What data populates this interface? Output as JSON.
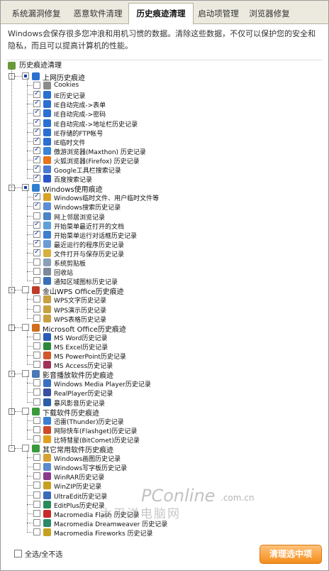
{
  "tabs": [
    "系统漏洞修复",
    "恶意软件清理",
    "历史痕迹清理",
    "启动项管理",
    "浏览器修复"
  ],
  "description": "Windows会保存很多您冲浪和用机习惯的数据。清除这些数据，不仅可以保护您的安全和隐私，而且可以提高计算机的性能。",
  "tree_root": "历史痕迹清理",
  "groups": [
    {
      "label": "上网历史痕迹",
      "state": "part",
      "color": "#2b6fd1",
      "items": [
        {
          "label": "Cookies",
          "checked": false,
          "icon": "#8b8b8b"
        },
        {
          "label": "IE历史记录",
          "checked": true,
          "icon": "#2b6fd1"
        },
        {
          "label": "IE自动完成->表单",
          "checked": true,
          "icon": "#2b6fd1"
        },
        {
          "label": "IE自动完成->密码",
          "checked": true,
          "icon": "#2b6fd1"
        },
        {
          "label": "IE自动完成->地址栏历史记录",
          "checked": true,
          "icon": "#2b6fd1"
        },
        {
          "label": "IE存储的FTP帐号",
          "checked": true,
          "icon": "#2b6fd1"
        },
        {
          "label": "IE临时文件",
          "checked": true,
          "icon": "#2b6fd1"
        },
        {
          "label": "傲游浏览器(Maxthon) 历史记录",
          "checked": true,
          "icon": "#3a84d8"
        },
        {
          "label": "火狐浏览器(Firefox) 历史记录",
          "checked": true,
          "icon": "#e8731c"
        },
        {
          "label": "Google工具栏搜索记录",
          "checked": true,
          "icon": "#4a7bd1"
        },
        {
          "label": "百度搜索记录",
          "checked": true,
          "icon": "#2a57c8"
        }
      ]
    },
    {
      "label": "Windows使用痕迹",
      "state": "part",
      "color": "#2f7fd0",
      "items": [
        {
          "label": "Windows临时文件、用户临时文件等",
          "checked": true,
          "icon": "#d9a326"
        },
        {
          "label": "Windows搜索历史记录",
          "checked": true,
          "icon": "#5b8ed6"
        },
        {
          "label": "网上邻居浏览记录",
          "checked": false,
          "icon": "#4b84c7"
        },
        {
          "label": "开始菜单最近打开的文档",
          "checked": true,
          "icon": "#5fa0d8"
        },
        {
          "label": "开始菜单运行对话框历史记录",
          "checked": true,
          "icon": "#3f7fd0"
        },
        {
          "label": "最近运行的程序历史记录",
          "checked": true,
          "icon": "#6a9ad8"
        },
        {
          "label": "文件打开与保存历史记录",
          "checked": true,
          "icon": "#d8b040"
        },
        {
          "label": "系统剪贴板",
          "checked": false,
          "icon": "#8aa0b8"
        },
        {
          "label": "回收站",
          "checked": false,
          "icon": "#7b8a9a"
        },
        {
          "label": "通知区域图标历史记录",
          "checked": false,
          "icon": "#3a6fb8"
        }
      ]
    },
    {
      "label": "金山WPS Office历史痕迹",
      "state": "none",
      "color": "#c03b28",
      "items": [
        {
          "label": "WPS文字历史记录",
          "checked": false,
          "icon": "#c8a040"
        },
        {
          "label": "WPS演示历史记录",
          "checked": false,
          "icon": "#c8a040"
        },
        {
          "label": "WPS表格历史记录",
          "checked": false,
          "icon": "#c8a040"
        }
      ]
    },
    {
      "label": "Microsoft Office历史痕迹",
      "state": "none",
      "color": "#d36b1c",
      "items": [
        {
          "label": "MS Word历史记录",
          "checked": false,
          "icon": "#2a5bb8"
        },
        {
          "label": "MS Excel历史记录",
          "checked": false,
          "icon": "#2a8a3a"
        },
        {
          "label": "MS PowerPoint历史记录",
          "checked": false,
          "icon": "#d0582a"
        },
        {
          "label": "MS Access历史记录",
          "checked": false,
          "icon": "#a0325a"
        }
      ]
    },
    {
      "label": "影音播放软件历史痕迹",
      "state": "none",
      "color": "#4a78b8",
      "items": [
        {
          "label": "Windows Media Player历史记录",
          "checked": false,
          "icon": "#3a6fc0"
        },
        {
          "label": "RealPlayer历史记录",
          "checked": false,
          "icon": "#3a4fa0"
        },
        {
          "label": "暴风影音历史记录",
          "checked": false,
          "icon": "#2a5fa8"
        }
      ]
    },
    {
      "label": "下载软件历史痕迹",
      "state": "none",
      "color": "#3a9a3a",
      "items": [
        {
          "label": "迅雷(Thunder)历史记录",
          "checked": false,
          "icon": "#3a7fd0"
        },
        {
          "label": "网际快车(Flashget)历史记录",
          "checked": false,
          "icon": "#d04a2a"
        },
        {
          "label": "比特彗星(BitComet)历史记录",
          "checked": false,
          "icon": "#e0a020"
        }
      ]
    },
    {
      "label": "其它常用软件历史痕迹",
      "state": "none",
      "color": "#3a9a3a",
      "items": [
        {
          "label": "Windows画图历史记录",
          "checked": false,
          "icon": "#d8a030"
        },
        {
          "label": "Windows写字板历史记录",
          "checked": false,
          "icon": "#5a8ad0"
        },
        {
          "label": "WinRAR历史记录",
          "checked": false,
          "icon": "#8a3a8a"
        },
        {
          "label": "WinZIP历史记录",
          "checked": false,
          "icon": "#c8a020"
        },
        {
          "label": "UltraEdit历史记录",
          "checked": false,
          "icon": "#3a6ab8"
        },
        {
          "label": "EditPlus历史纪录",
          "checked": false,
          "icon": "#2a8a5a"
        },
        {
          "label": "Macromedia Flash 历史记录",
          "checked": false,
          "icon": "#c82a2a"
        },
        {
          "label": "Macromedia Dreamweaver 历史记录",
          "checked": false,
          "icon": "#2a8a6a"
        },
        {
          "label": "Macromedia Fireworks 历史记录",
          "checked": false,
          "icon": "#c8a020"
        }
      ]
    }
  ],
  "select_all_label": "全选/全不选",
  "clean_button": "清理选中项",
  "watermark": {
    "logo": "PConline",
    "domain": ".com.cn",
    "cn": "太平洋电脑网"
  }
}
